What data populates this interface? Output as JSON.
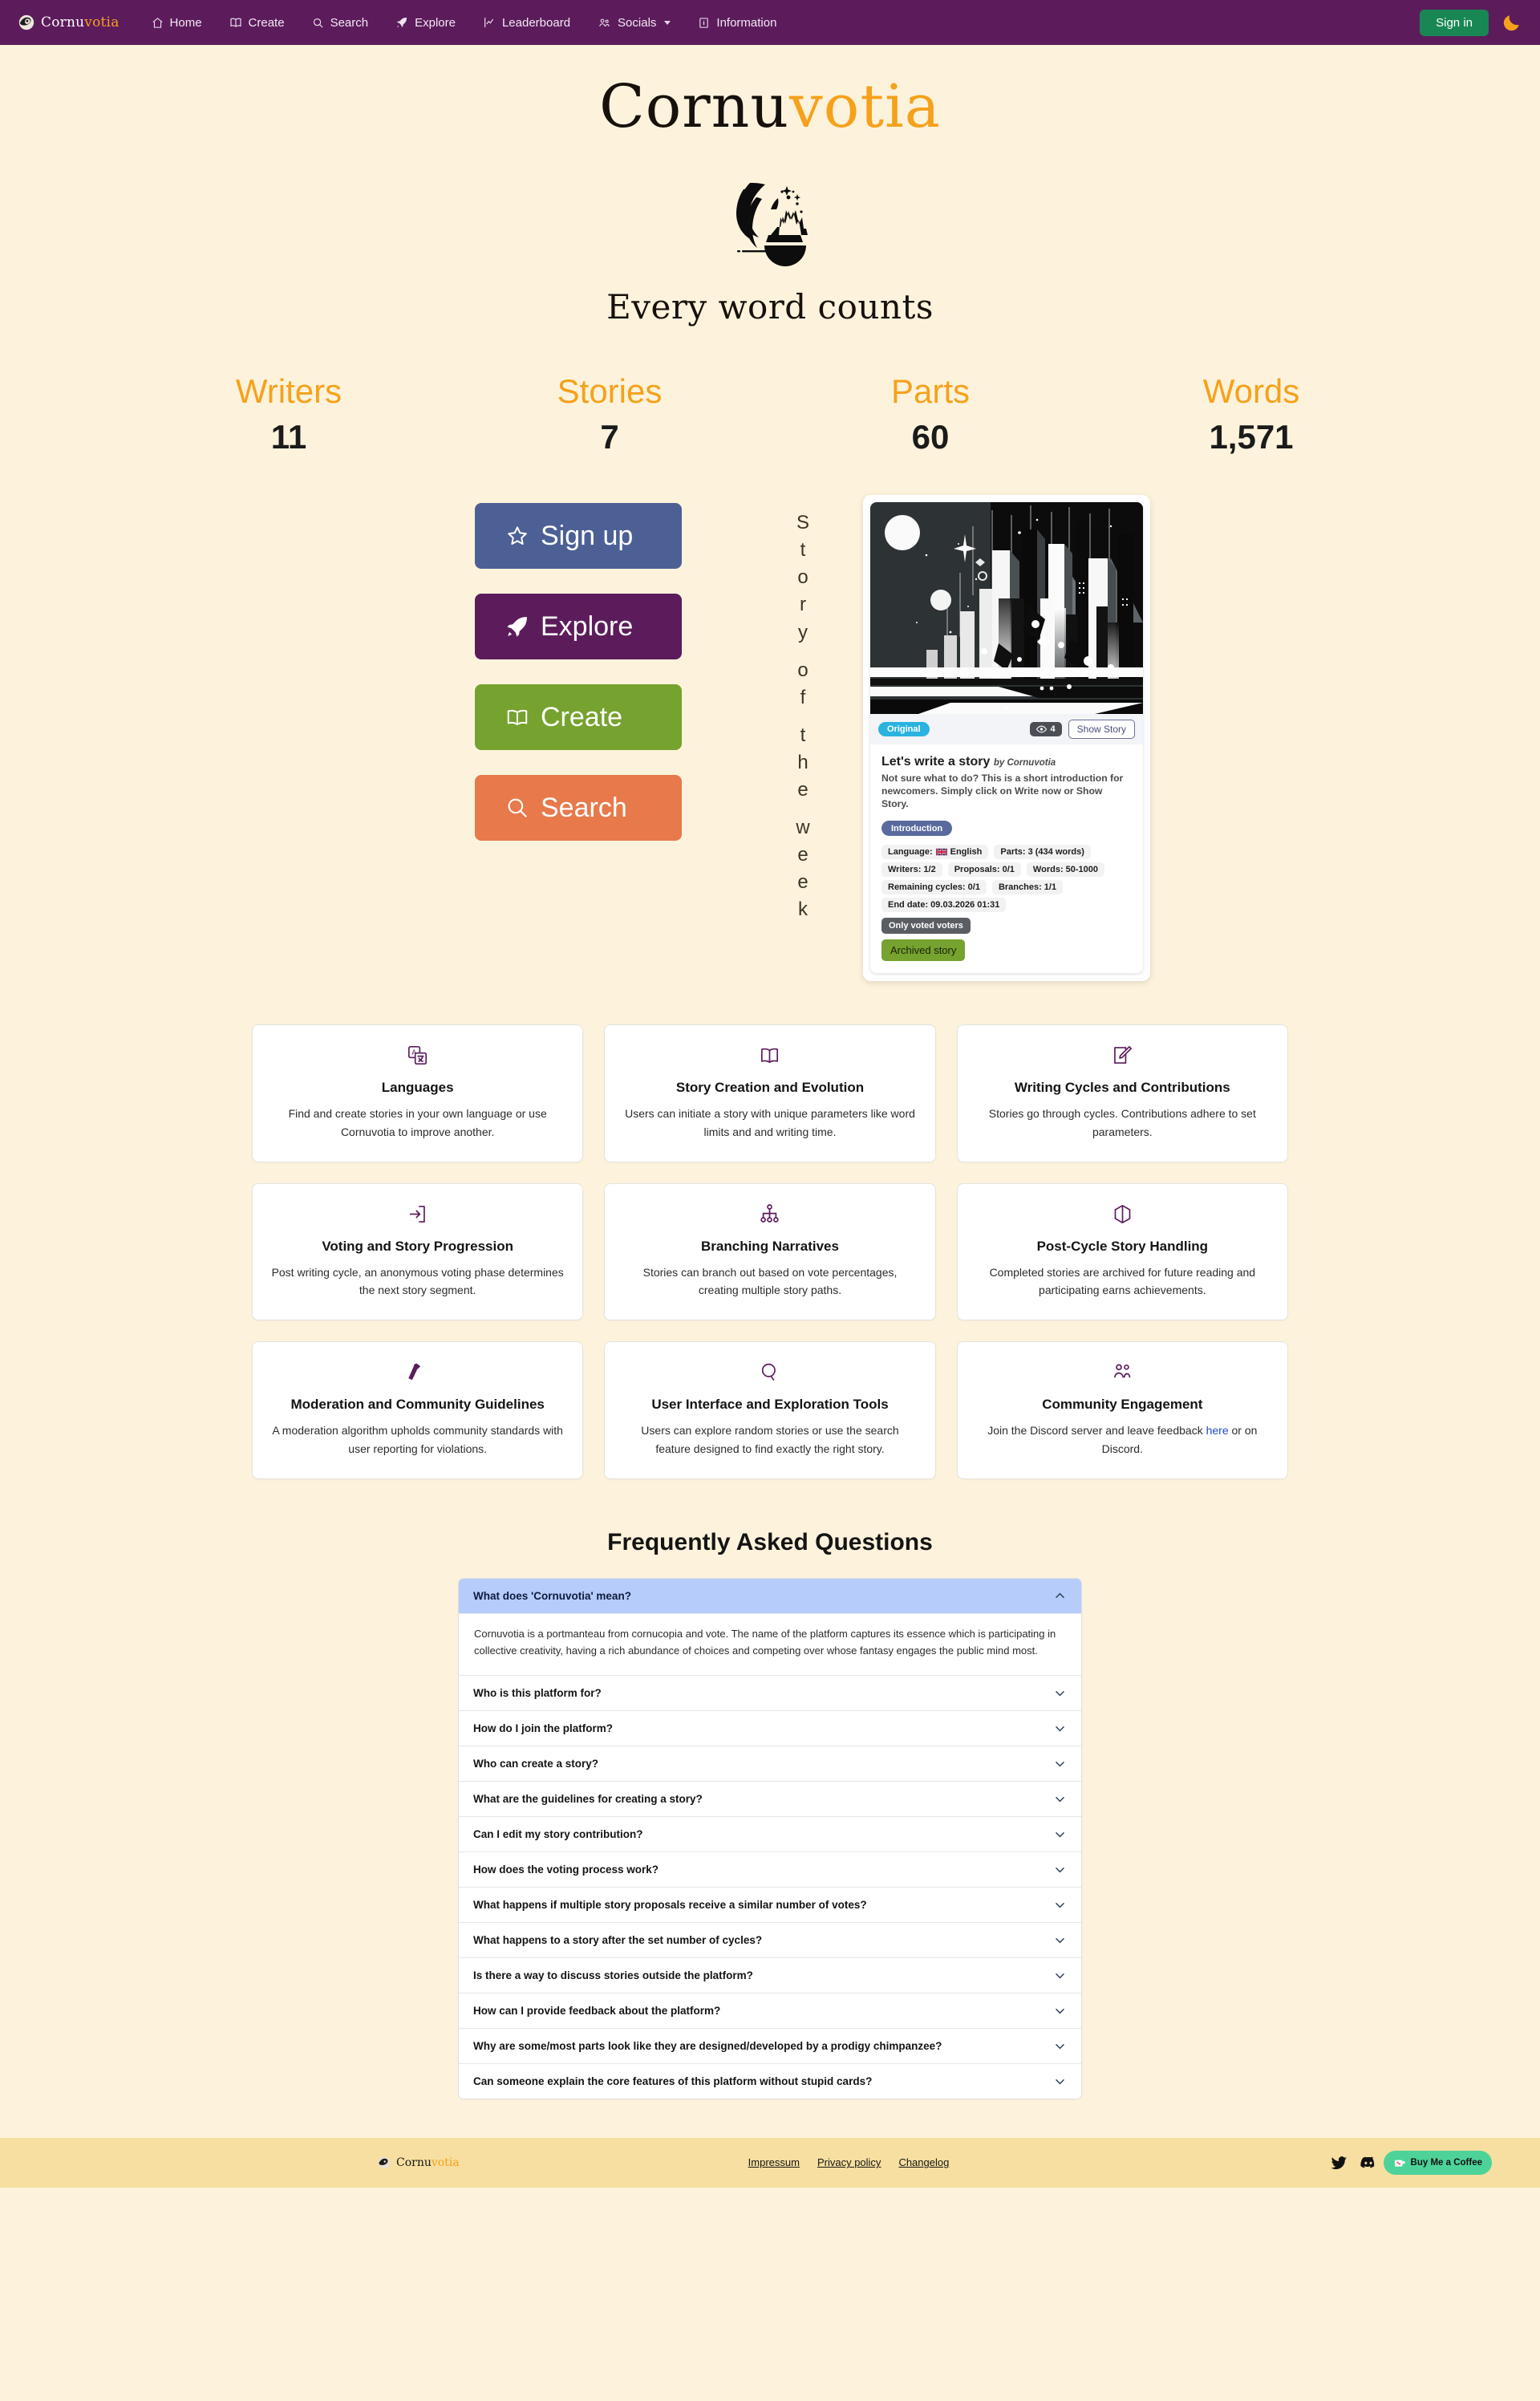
{
  "nav": {
    "brand": {
      "word1": "Cornu",
      "word2": "votia",
      "icon": "cornucopia-logo-icon"
    },
    "links": [
      {
        "label": "Home",
        "icon": "home-icon"
      },
      {
        "label": "Create",
        "icon": "book-open-icon"
      },
      {
        "label": "Search",
        "icon": "search-icon"
      },
      {
        "label": "Explore",
        "icon": "rocket-icon"
      },
      {
        "label": "Leaderboard",
        "icon": "chart-line-icon"
      },
      {
        "label": "Socials",
        "icon": "users-icon",
        "dropdown": true
      },
      {
        "label": "Information",
        "icon": "info-icon"
      }
    ],
    "sign_in_label": "Sign in",
    "theme_toggle_icon": "moon-icon",
    "accent_color": "#5c1c5c",
    "signin_color": "#198754"
  },
  "hero": {
    "title_part1": "Cornu",
    "title_part2": "votia",
    "logo_icon": "quill-castle-logo-icon",
    "tagline": "Every word counts"
  },
  "stats": [
    {
      "label": "Writers",
      "value": "11"
    },
    {
      "label": "Stories",
      "value": "7"
    },
    {
      "label": "Parts",
      "value": "60"
    },
    {
      "label": "Words",
      "value": "1,571"
    }
  ],
  "cta_buttons": [
    {
      "label": "Sign up",
      "icon": "star-icon",
      "color": "#4d6096"
    },
    {
      "label": "Explore",
      "icon": "rocket-icon",
      "color": "#5c1c5c"
    },
    {
      "label": "Create",
      "icon": "book-open-icon",
      "color": "#76a22f"
    },
    {
      "label": "Search",
      "icon": "search-icon",
      "color": "#e8794b"
    }
  ],
  "story_of_the_week_label": "Story of the week",
  "story_card": {
    "image_alt": "abstract monochrome futuristic cityscape",
    "badge": "Original",
    "views": "4",
    "show_story_label": "Show Story",
    "title": "Let's write a story",
    "author": "by Cornuvotia",
    "description": "Not sure what to do? This is a short introduction for newcomers. Simply click on Write now or Show Story.",
    "tag": "Introduction",
    "meta": [
      [
        "Language: English",
        "Parts: 3 (434 words)"
      ],
      [
        "Writers: 1/2",
        "Proposals: 0/1",
        "Words: 50-1000"
      ],
      [
        "Remaining cycles: 0/1",
        "Branches: 1/1"
      ],
      [
        "End date: 09.03.2026 01:31"
      ]
    ],
    "language_label_prefix": "Language:",
    "language_value": "English",
    "voters_note": "Only voted voters",
    "archived_label": "Archived story"
  },
  "features": [
    {
      "icon": "translate-icon",
      "title": "Languages",
      "desc": "Find and create stories in your own language or use Cornuvotia to improve another."
    },
    {
      "icon": "book-open-icon",
      "title": "Story Creation and Evolution",
      "desc": "Users can initiate a story with unique parameters like word limits and and writing time."
    },
    {
      "icon": "pencil-square-icon",
      "title": "Writing Cycles and Contributions",
      "desc": "Stories go through cycles. Contributions adhere to set parameters."
    },
    {
      "icon": "login-arrow-icon",
      "title": "Voting and Story Progression",
      "desc": "Post writing cycle, an anonymous voting phase determines the next story segment."
    },
    {
      "icon": "sitemap-branch-icon",
      "title": "Branching Narratives",
      "desc": "Stories can branch out based on vote percentages, creating multiple story paths."
    },
    {
      "icon": "box-archive-icon",
      "title": "Post-Cycle Story Handling",
      "desc": "Completed stories are archived for future reading and participating earns achievements."
    },
    {
      "icon": "gavel-icon",
      "title": "Moderation and Community Guidelines",
      "desc": "A moderation algorithm upholds community standards with user reporting for violations."
    },
    {
      "icon": "search-icon",
      "title": "User Interface and Exploration Tools",
      "desc": "Users can explore random stories or use the search feature designed to find exactly the right story."
    },
    {
      "icon": "users-icon",
      "title": "Community Engagement",
      "desc_before": "Join the Discord server and leave feedback ",
      "desc_link": "here",
      "desc_after": " or on Discord."
    }
  ],
  "faq": {
    "heading": "Frequently Asked Questions",
    "items": [
      {
        "q": "What does 'Cornuvotia' mean?",
        "a": "Cornuvotia is a portmanteau from cornucopia and vote. The name of the platform captures its essence which is participating in collective creativity, having a rich abundance of choices and competing over whose fantasy engages the public mind most.",
        "open": true
      },
      {
        "q": "Who is this platform for?",
        "open": false
      },
      {
        "q": "How do I join the platform?",
        "open": false
      },
      {
        "q": "Who can create a story?",
        "open": false
      },
      {
        "q": "What are the guidelines for creating a story?",
        "open": false
      },
      {
        "q": "Can I edit my story contribution?",
        "open": false
      },
      {
        "q": "How does the voting process work?",
        "open": false
      },
      {
        "q": "What happens if multiple story proposals receive a similar number of votes?",
        "open": false
      },
      {
        "q": "What happens to a story after the set number of cycles?",
        "open": false
      },
      {
        "q": "Is there a way to discuss stories outside the platform?",
        "open": false
      },
      {
        "q": "How can I provide feedback about the platform?",
        "open": false
      },
      {
        "q": "Why are some/most parts look like they are designed/developed by a prodigy chimpanzee?",
        "open": false
      },
      {
        "q": "Can someone explain the core features of this platform without stupid cards?",
        "open": false
      }
    ]
  },
  "footer": {
    "brand_word1": "Cornu",
    "brand_word2": "votia",
    "links": [
      "Impressum",
      "Privacy policy",
      "Changelog"
    ],
    "social": [
      {
        "icon": "twitter-icon"
      },
      {
        "icon": "discord-icon"
      }
    ],
    "bmc_label": "Buy Me a Coffee",
    "bmc_icon": "coffee-cup-icon",
    "bg_color": "#f6dfa0"
  }
}
